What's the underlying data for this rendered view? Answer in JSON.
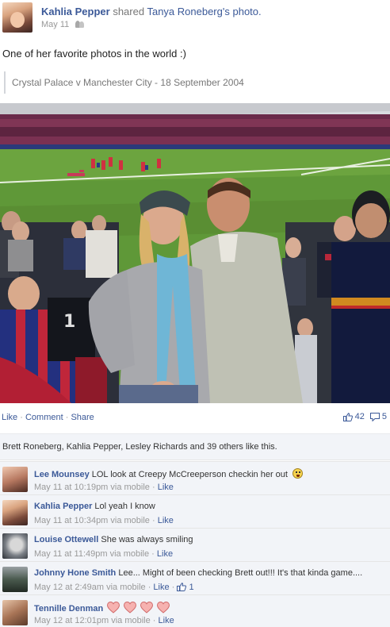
{
  "post": {
    "author": "Kahlia Pepper",
    "shared_text": "shared",
    "original_owner": "Tanya Roneberg's",
    "photo_word": "photo.",
    "date": "May 11",
    "audience_icon": "friends-icon",
    "status_text": "One of her favorite photos in the world :)",
    "photo_caption": "Crystal Palace v Manchester City - 18 September 2004"
  },
  "actions": {
    "like": "Like",
    "sep1": " · ",
    "comment": "Comment",
    "sep2": " · ",
    "share": "Share",
    "like_count": "42",
    "comment_count": "5",
    "like_icon": "thumbs-up-icon",
    "comment_icon": "comment-icon"
  },
  "likes_summary": "Brett Roneberg, Kahlia Pepper, Lesley Richards and 39 others like this.",
  "comments": [
    {
      "name": "Lee Mounsey",
      "text": "LOL look at Creepy McCreeperson checkin her out",
      "emoji": "grimace-emoji-icon",
      "time": "May 11 at 10:19pm via mobile",
      "dot": " · ",
      "like": "Like",
      "likes": ""
    },
    {
      "name": "Kahlia Pepper",
      "text": "Lol yeah I know",
      "time": "May 11 at 10:34pm via mobile",
      "dot": " · ",
      "like": "Like",
      "likes": ""
    },
    {
      "name": "Louise Ottewell",
      "text": "She was always smiling",
      "time": "May 11 at 11:49pm via mobile",
      "dot": " · ",
      "like": "Like",
      "likes": ""
    },
    {
      "name": "Johnny Hone Smith",
      "text": "Lee... Might of been checking Brett out!!! It's that kinda game....",
      "time": "May 12 at 2:49am via mobile",
      "dot": " · ",
      "like": "Like",
      "dot2": " · ",
      "likes": "1"
    },
    {
      "name": "Tennille Denman",
      "text": "",
      "emoji": "heart-icon",
      "time": "May 12 at 12:01pm via mobile",
      "dot": " · ",
      "like": "Like",
      "likes": ""
    }
  ],
  "colors": {
    "link": "#3b5998",
    "meta": "#999999",
    "bar_bg": "#f2f4f8"
  }
}
